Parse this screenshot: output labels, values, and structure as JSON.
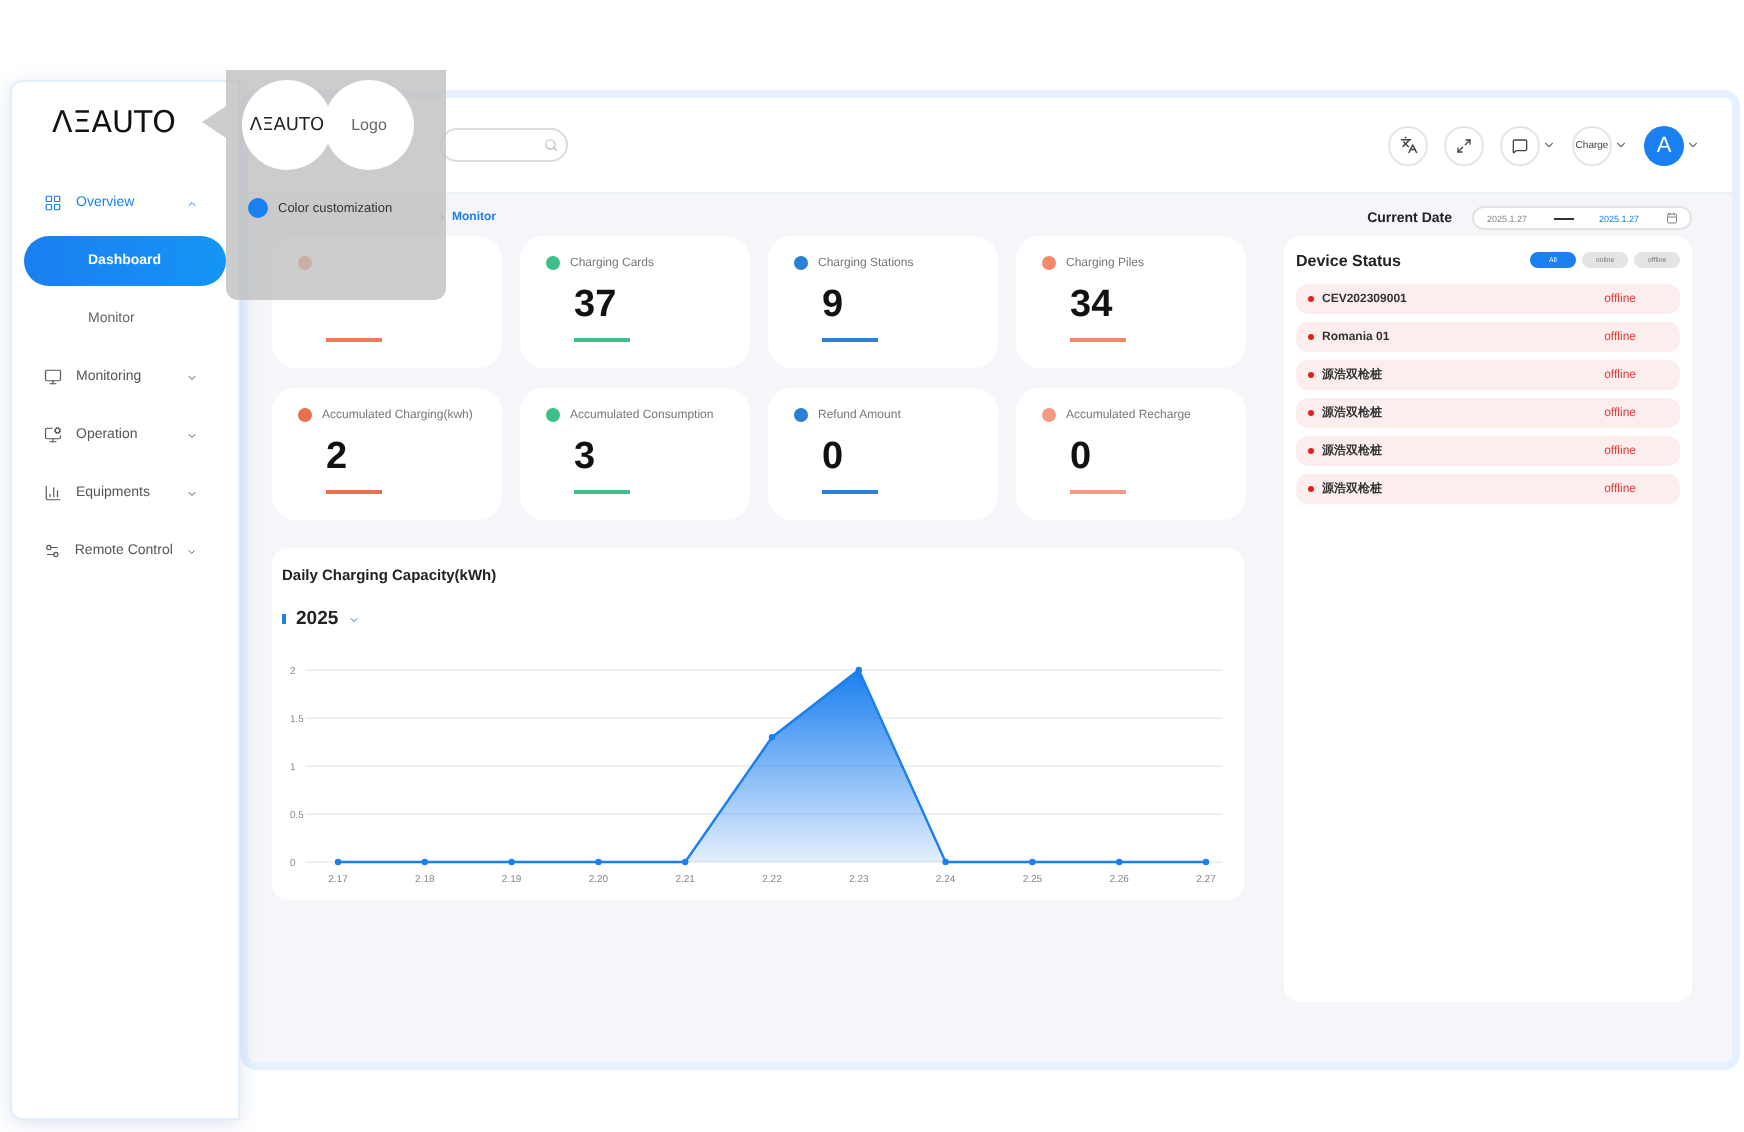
{
  "logo": "ΛΞAUTO",
  "popup": {
    "logo_from": "ΛΞAUTO",
    "logo_to": "Logo",
    "option": "Color customization"
  },
  "sidebar": {
    "items": [
      {
        "label": "Overview",
        "expanded": true,
        "children": [
          {
            "label": "Dashboard",
            "selected": true
          },
          {
            "label": "Monitor",
            "selected": false
          }
        ]
      },
      {
        "label": "Monitoring",
        "expanded": false
      },
      {
        "label": "Operation",
        "expanded": false
      },
      {
        "label": "Equipments",
        "expanded": false
      },
      {
        "label": "Remote Control",
        "expanded": false
      }
    ]
  },
  "header": {
    "charge_label": "Charge",
    "avatar": "A"
  },
  "breadcrumb": "Monitor",
  "date": {
    "label": "Current Date",
    "start": "2025.1.27",
    "end": "2025.1.27"
  },
  "stats": [
    {
      "color": "#ee7a55"
    },
    {
      "label": "Charging Cards",
      "value": "37",
      "color": "#3cc08a"
    },
    {
      "label": "Charging Stations",
      "value": "9",
      "color": "#2b7fd4"
    },
    {
      "label": "Charging Piles",
      "value": "34",
      "color": "#f08a6a"
    },
    {
      "label": "Accumulated Charging(kwh)",
      "value": "2",
      "color": "#e8704e"
    },
    {
      "label": "Accumulated Consumption",
      "value": "3",
      "color": "#3cc08a"
    },
    {
      "label": "Refund Amount",
      "value": "0",
      "color": "#2b7fd4"
    },
    {
      "label": "Accumulated Recharge",
      "value": "0",
      "color": "#f59a82"
    }
  ],
  "chart": {
    "title": "Daily Charging Capacity(kWh)",
    "chart_data": {
      "type": "area",
      "categories": [
        "2.17",
        "2.18",
        "2.19",
        "2.20",
        "2.21",
        "2.22",
        "2.23",
        "2.24",
        "2.25",
        "2.26",
        "2.27"
      ],
      "series": [
        {
          "name": "2025",
          "color": "#1a7ff0",
          "values": [
            0,
            0,
            0,
            0,
            0,
            1.3,
            2,
            0,
            0,
            0,
            0
          ]
        }
      ],
      "ylim": [
        0,
        2
      ],
      "grid": true,
      "yticks": [
        0,
        0.5,
        1,
        1.5,
        2
      ]
    }
  },
  "device_status": {
    "title": "Device Status",
    "filters": [
      {
        "label": "All",
        "selected": true
      },
      {
        "label": "online",
        "selected": false
      },
      {
        "label": "offline",
        "selected": false
      }
    ],
    "devices": [
      {
        "name": "CEV202309001",
        "status": "offline"
      },
      {
        "name": "Romania 01",
        "status": "offline"
      },
      {
        "name": "源浩双枪桩",
        "status": "offline"
      },
      {
        "name": "源浩双枪桩",
        "status": "offline"
      },
      {
        "name": "源浩双枪桩",
        "status": "offline"
      },
      {
        "name": "源浩双枪桩",
        "status": "offline"
      }
    ]
  }
}
